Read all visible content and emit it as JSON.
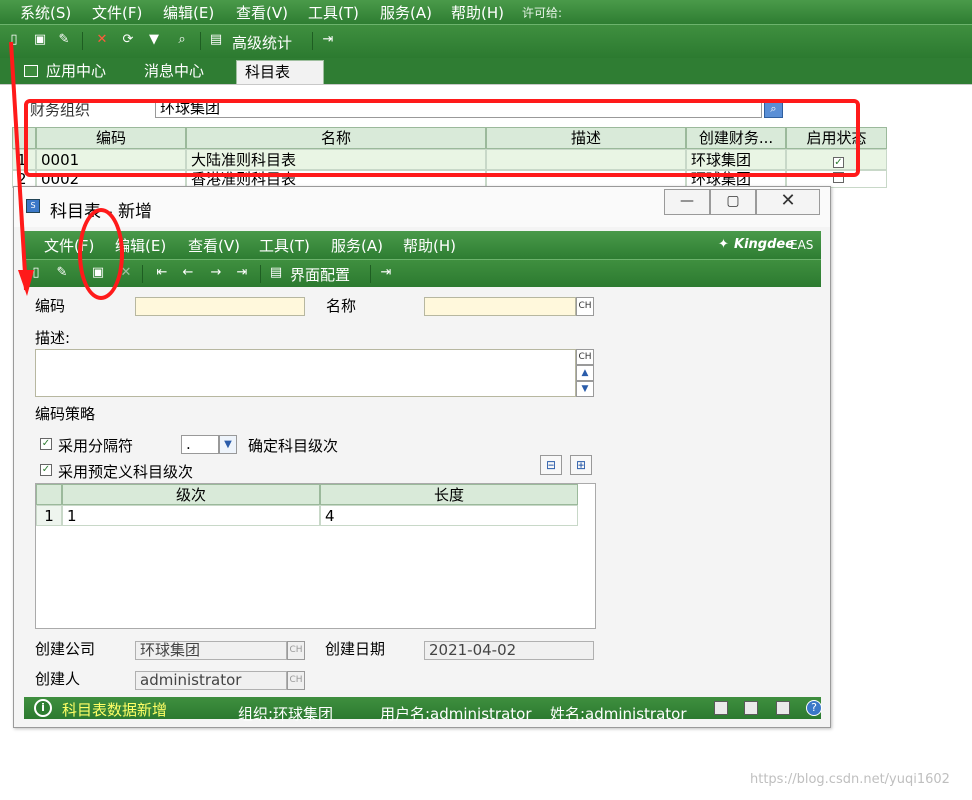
{
  "app": {
    "menu": [
      "系统(S)",
      "文件(F)",
      "编辑(E)",
      "查看(V)",
      "工具(T)",
      "服务(A)",
      "帮助(H)"
    ],
    "license": "许可给:",
    "toolbar": {
      "stats_label": "高级统计"
    },
    "tabs": [
      "应用中心",
      "消息中心",
      "科目表"
    ]
  },
  "filter": {
    "label": "财务组织",
    "value": "环球集团"
  },
  "main_grid": {
    "columns": [
      "编码",
      "名称",
      "描述",
      "创建财务...",
      "启用状态"
    ],
    "rows": [
      {
        "num": "1",
        "code": "0001",
        "name": "大陆准则科目表",
        "desc": "",
        "org": "环球集团",
        "enabled": true
      },
      {
        "num": "2",
        "code": "0002",
        "name": "香港准则科目表",
        "desc": "",
        "org": "环球集团",
        "enabled": false
      }
    ]
  },
  "dialog": {
    "title": "科目表 - 新增",
    "menu": [
      "文件(F)",
      "编辑(E)",
      "查看(V)",
      "工具(T)",
      "服务(A)",
      "帮助(H)"
    ],
    "brand": "Kingdee",
    "brand_suffix": "EAS",
    "toolbar": {
      "layout_label": "界面配置"
    },
    "form": {
      "code_label": "编码",
      "name_label": "名称",
      "desc_label": "描述:",
      "strategy_label": "编码策略",
      "use_separator_label": "采用分隔符",
      "separator_value": ".",
      "confirm_level_label": "确定科目级次",
      "use_predefined_label": "采用预定义科目级次",
      "ch_label": "CH"
    },
    "level_grid": {
      "columns": [
        "级次",
        "长度"
      ],
      "rows": [
        {
          "num": "1",
          "level": "1",
          "length": "4"
        }
      ]
    },
    "footer": {
      "company_label": "创建公司",
      "company_value": "环球集团",
      "date_label": "创建日期",
      "date_value": "2021-04-02",
      "creator_label": "创建人",
      "creator_value": "administrator"
    },
    "status": {
      "message": "科目表数据新增",
      "org": "组织:环球集团",
      "user": "用户名:administrator",
      "name": "姓名:administrator"
    }
  },
  "watermark": "https://blog.csdn.net/yuqi1602",
  "colors": {
    "accent": "#2e7d32",
    "annotation": "#ff1a1a",
    "status_text": "#ffff66"
  }
}
